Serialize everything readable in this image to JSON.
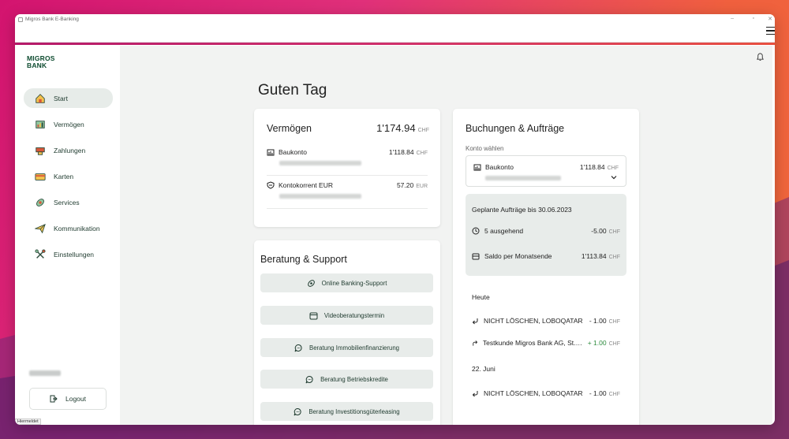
{
  "window": {
    "title": "Migros Bank E-Banking",
    "status_text": "Hiermeldet"
  },
  "brand": {
    "logo_line1": "MIGROS",
    "logo_line2": "BANK",
    "color": "#0d4b2f",
    "accent": "#2e8b3e"
  },
  "sidebar": {
    "items": [
      {
        "label": "Start",
        "icon": "home-icon",
        "active": true
      },
      {
        "label": "Vermögen",
        "icon": "assets-icon"
      },
      {
        "label": "Zahlungen",
        "icon": "payments-icon"
      },
      {
        "label": "Karten",
        "icon": "card-icon"
      },
      {
        "label": "Services",
        "icon": "services-icon"
      },
      {
        "label": "Kommunikation",
        "icon": "paper-plane-icon"
      },
      {
        "label": "Einstellungen",
        "icon": "tools-icon"
      }
    ],
    "logout_label": "Logout"
  },
  "main": {
    "greeting": "Guten Tag"
  },
  "vermoegen": {
    "title": "Vermögen",
    "total": "1'174.94",
    "currency": "CHF",
    "accounts": [
      {
        "name": "Baukonto",
        "amount": "1'118.84",
        "currency": "CHF"
      },
      {
        "name": "Kontokorrent EUR",
        "amount": "57.20",
        "currency": "EUR"
      }
    ]
  },
  "beratung": {
    "title": "Beratung & Support",
    "buttons": [
      {
        "label": "Online Banking-Support",
        "icon": "support-icon"
      },
      {
        "label": "Videoberatungstermin",
        "icon": "calendar-icon"
      },
      {
        "label": "Beratung Immobilienfinanzierung",
        "icon": "chat-icon"
      },
      {
        "label": "Beratung Betriebskredite",
        "icon": "chat-icon"
      },
      {
        "label": "Beratung Investitionsgüterleasing",
        "icon": "chat-icon"
      }
    ]
  },
  "buchungen": {
    "title": "Buchungen & Aufträge",
    "select_label": "Konto wählen",
    "selected_account": {
      "name": "Baukonto",
      "amount": "1'118.84",
      "currency": "CHF"
    },
    "planned": {
      "header": "Geplante Aufträge bis 30.06.2023",
      "rows": [
        {
          "label": "5 ausgehend",
          "amount": "-5.00",
          "currency": "CHF",
          "icon": "clock-icon"
        },
        {
          "label": "Saldo per Monatsende",
          "amount": "1'113.84",
          "currency": "CHF",
          "icon": "wallet-icon"
        }
      ]
    },
    "groups": [
      {
        "day": "Heute",
        "transactions": [
          {
            "name": "NICHT LÖSCHEN, LOBOQATAR",
            "amount": "- 1.00",
            "currency": "CHF",
            "direction": "in"
          },
          {
            "name": "Testkunde Migros Bank AG, St. Gallen",
            "amount": "+ 1.00",
            "currency": "CHF",
            "direction": "out"
          }
        ]
      },
      {
        "day": "22. Juni",
        "transactions": [
          {
            "name": "NICHT LÖSCHEN, LOBOQATAR",
            "amount": "- 1.00",
            "currency": "CHF",
            "direction": "in"
          }
        ]
      }
    ]
  }
}
